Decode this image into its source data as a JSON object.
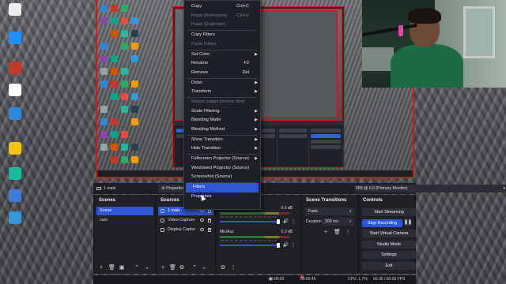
{
  "colors": {
    "accent": "#2d57d6",
    "recording_border": "#d01818",
    "panel": "#1f2127"
  },
  "desktop": {
    "icons": [
      {
        "name": "obs-app-icon",
        "label": "",
        "color": "#eeeeee"
      },
      {
        "name": "app-icon-2",
        "label": "",
        "color": "#1e90ff"
      },
      {
        "name": "app-icon-3",
        "label": "",
        "color": "#c0392b"
      },
      {
        "name": "app-icon-4",
        "label": "",
        "color": "#ffffff"
      },
      {
        "name": "app-icon-5",
        "label": "",
        "color": "#2e86de"
      },
      {
        "name": "app-icon-6",
        "label": "",
        "color": "#f1c40f"
      },
      {
        "name": "app-icon-7",
        "label": "",
        "color": "#1abc9c"
      },
      {
        "name": "app-icon-8",
        "label": "",
        "color": "#3d7bd6"
      },
      {
        "name": "app-icon-9",
        "label": "",
        "color": "#3498db"
      }
    ]
  },
  "context_menu": {
    "items": [
      {
        "label": "Copy",
        "shortcut": "Ctrl+C",
        "disabled": false,
        "submenu": false
      },
      {
        "label": "Paste (Reference)",
        "shortcut": "Ctrl+V",
        "disabled": true,
        "submenu": false
      },
      {
        "label": "Paste (Duplicate)",
        "shortcut": "",
        "disabled": true,
        "submenu": false
      },
      {
        "sep": true
      },
      {
        "label": "Copy Filters",
        "shortcut": "",
        "disabled": false,
        "submenu": false
      },
      {
        "label": "Paste Filters",
        "shortcut": "",
        "disabled": true,
        "submenu": false
      },
      {
        "sep": true
      },
      {
        "label": "Set Color",
        "shortcut": "",
        "disabled": false,
        "submenu": true
      },
      {
        "label": "Rename",
        "shortcut": "F2",
        "disabled": false,
        "submenu": false
      },
      {
        "label": "Remove",
        "shortcut": "Del",
        "disabled": false,
        "submenu": false
      },
      {
        "sep": true
      },
      {
        "label": "Order",
        "shortcut": "",
        "disabled": false,
        "submenu": true
      },
      {
        "label": "Transform",
        "shortcut": "",
        "disabled": false,
        "submenu": true
      },
      {
        "sep": true
      },
      {
        "label": "Resize output (source size)",
        "shortcut": "",
        "disabled": true,
        "submenu": false
      },
      {
        "label": "Scale Filtering",
        "shortcut": "",
        "disabled": false,
        "submenu": true
      },
      {
        "label": "Blending Mode",
        "shortcut": "",
        "disabled": false,
        "submenu": true
      },
      {
        "label": "Blending Method",
        "shortcut": "",
        "disabled": false,
        "submenu": true
      },
      {
        "sep": true
      },
      {
        "label": "Show Transition",
        "shortcut": "",
        "disabled": false,
        "submenu": true
      },
      {
        "label": "Hide Transition",
        "shortcut": "",
        "disabled": false,
        "submenu": true
      },
      {
        "sep": true
      },
      {
        "label": "Fullscreen Projector (Source)",
        "shortcut": "",
        "disabled": false,
        "submenu": true
      },
      {
        "label": "Windowed Projector (Source)",
        "shortcut": "",
        "disabled": false,
        "submenu": false
      },
      {
        "label": "Screenshot (Source)",
        "shortcut": "",
        "disabled": false,
        "submenu": false
      },
      {
        "sep": true
      },
      {
        "label": "Filters",
        "shortcut": "",
        "disabled": false,
        "submenu": false,
        "highlighted": true
      },
      {
        "label": "Properties",
        "shortcut": "",
        "disabled": false,
        "submenu": false
      }
    ]
  },
  "source_toolbar": {
    "source_name": "1 main",
    "properties_label": "Properties",
    "display_value": "080 @ 0,0 (Primary Monitor)"
  },
  "scenes": {
    "title": "Scenes",
    "items": [
      {
        "label": "Scene",
        "selected": true
      },
      {
        "label": "cam",
        "selected": false
      }
    ]
  },
  "sources": {
    "title": "Sources",
    "items": [
      {
        "label": "1 main",
        "selected": true
      },
      {
        "label": "Video Capture",
        "selected": false
      },
      {
        "label": "Display Captur",
        "selected": false
      }
    ]
  },
  "mixer": {
    "tracks": [
      {
        "name": "Desktop Audio",
        "db": "0.0 dB"
      },
      {
        "name": "Mic/Aux",
        "db": "0.0 dB"
      }
    ],
    "ticks": "-60 -55 -50 -45 -40 -35 -30 -25 -20 -15 -10 -5 0"
  },
  "transitions": {
    "title": "Scene Transitions",
    "type": "Fade",
    "duration_label": "Duration",
    "duration_value": "300 ms"
  },
  "controls": {
    "title": "Controls",
    "buttons": [
      {
        "label": "Start Streaming",
        "active": false
      },
      {
        "label": "Stop Recording",
        "active": true
      },
      {
        "label": "Start Virtual Camera",
        "active": false
      },
      {
        "label": "Studio Mode",
        "active": false
      },
      {
        "label": "Settings",
        "active": false
      },
      {
        "label": "Exit",
        "active": false
      }
    ]
  },
  "status_bar": {
    "stream_time": "00:00:00",
    "rec_time": "00:00:45",
    "cpu": "CPU: 1.7%",
    "fps": "60.00 / 60.00 FPS"
  }
}
